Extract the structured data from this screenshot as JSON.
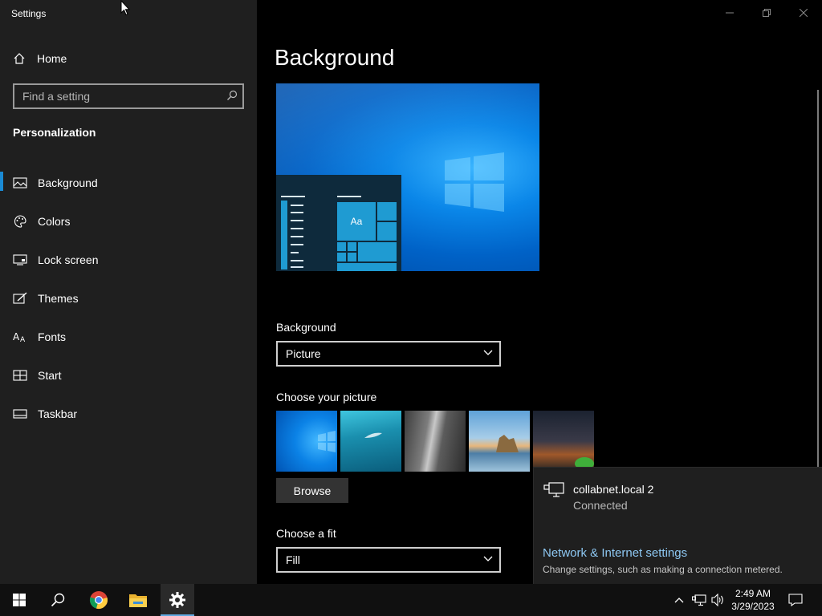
{
  "window": {
    "title": "Settings"
  },
  "sidebar": {
    "home_label": "Home",
    "search_placeholder": "Find a setting",
    "section_title": "Personalization",
    "items": [
      {
        "label": "Background",
        "icon": "picture-icon",
        "active": true
      },
      {
        "label": "Colors",
        "icon": "palette-icon",
        "active": false
      },
      {
        "label": "Lock screen",
        "icon": "monitor-icon",
        "active": false
      },
      {
        "label": "Themes",
        "icon": "brush-icon",
        "active": false
      },
      {
        "label": "Fonts",
        "icon": "font-icon",
        "active": false
      },
      {
        "label": "Start",
        "icon": "start-grid-icon",
        "active": false
      },
      {
        "label": "Taskbar",
        "icon": "taskbar-icon",
        "active": false
      }
    ]
  },
  "main": {
    "title": "Background",
    "preview_tile_text": "Aa",
    "background_label": "Background",
    "background_value": "Picture",
    "choose_picture_label": "Choose your picture",
    "browse_label": "Browse",
    "choose_fit_label": "Choose a fit",
    "fit_value": "Fill"
  },
  "network_flyout": {
    "network_name": "collabnet.local 2",
    "status": "Connected",
    "settings_link": "Network & Internet settings",
    "settings_desc": "Change settings, such as making a connection metered."
  },
  "taskbar": {
    "time": "2:49 AM",
    "date": "3/29/2023"
  },
  "colors": {
    "accent": "#1a8ad4",
    "link": "#8ec8f3",
    "sidebar_bg": "#1f1f1f",
    "main_bg": "#000000"
  }
}
